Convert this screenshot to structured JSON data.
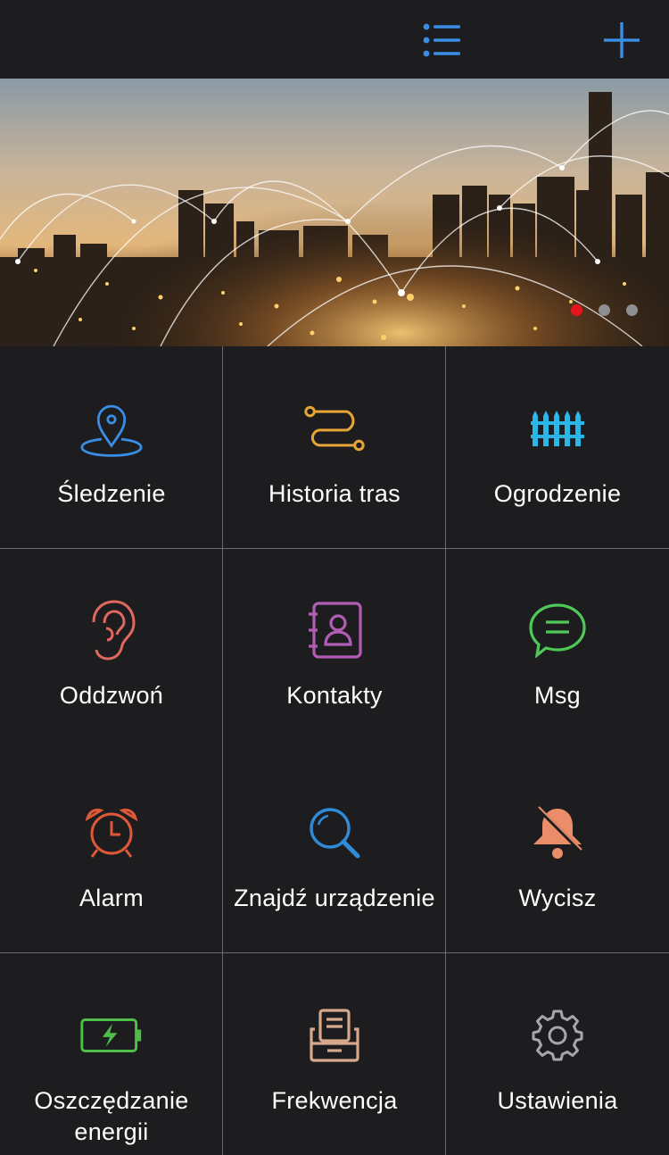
{
  "header": {
    "menu_icon": "list-icon",
    "add_icon": "plus-icon",
    "accent_color": "#3a8ee6"
  },
  "banner": {
    "image": "city-skyline-night-network",
    "pager": {
      "count": 3,
      "active_index": 0,
      "active_color": "#e8141b",
      "inactive_color": "#8e8e93"
    }
  },
  "menu": {
    "items": [
      {
        "label": "Śledzenie",
        "icon": "location-pin-icon",
        "color": "#3a8ee6"
      },
      {
        "label": "Historia tras",
        "icon": "route-history-icon",
        "color": "#e7a536"
      },
      {
        "label": "Ogrodzenie",
        "icon": "fence-icon",
        "color": "#2bb6e8"
      },
      {
        "label": "Oddzwoń",
        "icon": "ear-icon",
        "color": "#e0685f"
      },
      {
        "label": "Kontakty",
        "icon": "contacts-book-icon",
        "color": "#b15db5"
      },
      {
        "label": "Msg",
        "icon": "chat-bubble-icon",
        "color": "#4fc85a"
      },
      {
        "label": "Alarm",
        "icon": "alarm-clock-icon",
        "color": "#e0583a"
      },
      {
        "label": "Znajdź urządzenie",
        "icon": "search-icon",
        "color": "#2f8ad8"
      },
      {
        "label": "Wycisz",
        "icon": "bell-off-icon",
        "color": "#eb8d6a"
      },
      {
        "label": "Oszczędzanie energii",
        "icon": "battery-icon",
        "color": "#4fbf4a"
      },
      {
        "label": "Frekwencja",
        "icon": "attendance-printer-icon",
        "color": "#d7a98b"
      },
      {
        "label": "Ustawienia",
        "icon": "gear-icon",
        "color": "#a7a7aa"
      }
    ]
  }
}
